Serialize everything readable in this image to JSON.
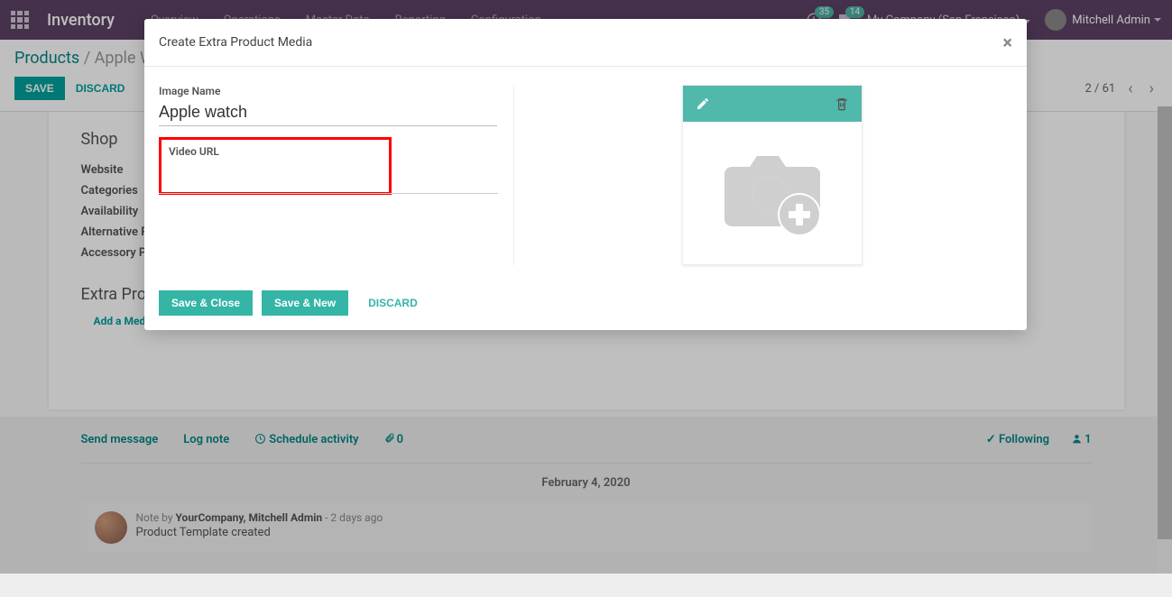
{
  "top_bar": {
    "app_title": "Inventory",
    "menu": [
      "Overview",
      "Operations",
      "Master Data",
      "Reporting",
      "Configuration"
    ],
    "badge1": "35",
    "badge2": "14",
    "company": "My Company (San Francisco)",
    "user_name": "Mitchell Admin"
  },
  "breadcrumb": {
    "root": "Products",
    "sep": " / ",
    "current": "Apple Watch"
  },
  "actions": {
    "save": "Save",
    "discard": "Discard"
  },
  "pager": {
    "position": "2 / 61"
  },
  "sheet": {
    "shop_title": "Shop",
    "fields": [
      "Website",
      "Categories",
      "Availability",
      "Alternative Products",
      "Accessory Products"
    ],
    "extra_title": "Extra Product Media",
    "add_media": "Add a Media"
  },
  "chatter": {
    "send": "Send message",
    "log": "Log note",
    "schedule": "Schedule activity",
    "attach_count": "0",
    "following": "Following",
    "followers": "1",
    "date": "February 4, 2020",
    "note_prefix": "Note by ",
    "note_author": "YourCompany, Mitchell Admin",
    "note_time": " - 2 days ago",
    "note_body": "Product Template created"
  },
  "modal": {
    "title": "Create Extra Product Media",
    "image_name_label": "Image Name",
    "image_name_value": "Apple watch",
    "video_url_label": "Video URL",
    "video_url_value": "",
    "save_close": "Save & Close",
    "save_new": "Save & New",
    "discard": "Discard"
  }
}
